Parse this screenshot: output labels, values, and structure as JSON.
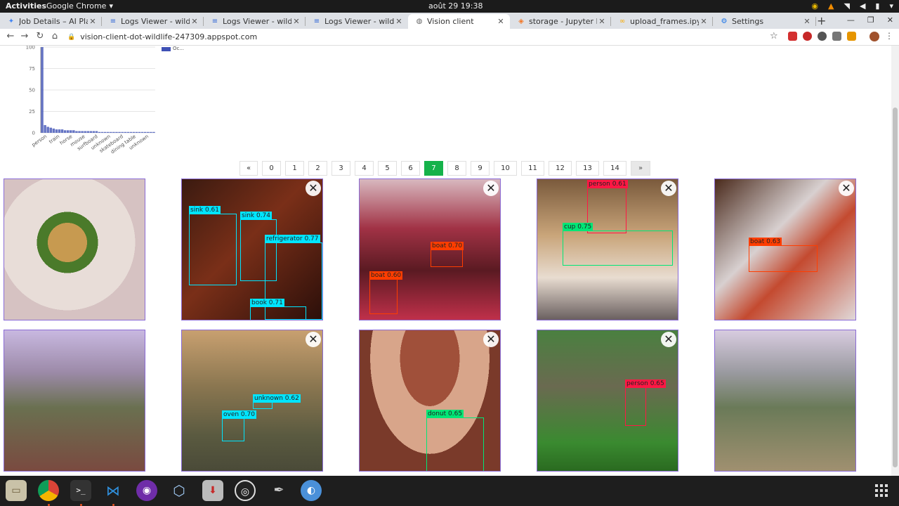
{
  "topbar": {
    "activities": "Activities",
    "app": "Google Chrome",
    "clock": "août 29  19:38"
  },
  "tabs": [
    {
      "label": "Job Details – AI Platfo",
      "icon": "ai-platform-icon",
      "icon_color": "#4285f4"
    },
    {
      "label": "Logs Viewer - wildlife",
      "icon": "logs-icon",
      "icon_color": "#3367d6"
    },
    {
      "label": "Logs Viewer - wildlife",
      "icon": "logs-icon",
      "icon_color": "#3367d6"
    },
    {
      "label": "Logs Viewer - wildlife",
      "icon": "logs-icon",
      "icon_color": "#3367d6"
    },
    {
      "label": "Vision client",
      "icon": "globe-icon",
      "icon_color": "#666666"
    },
    {
      "label": "storage - Jupyter Note",
      "icon": "jupyter-icon",
      "icon_color": "#f37726"
    },
    {
      "label": "upload_frames.ipynb",
      "icon": "colab-icon",
      "icon_color": "#f9ab00"
    },
    {
      "label": "Settings",
      "icon": "gear-icon",
      "icon_color": "#1a73e8"
    }
  ],
  "address": {
    "url": "vision-client-dot-wildlife-247309.appspot.com"
  },
  "chart_data": {
    "type": "bar",
    "categories": [
      "person",
      "",
      "train",
      "",
      "horse",
      "",
      "mouse",
      "",
      "surfboard",
      "",
      "unknown",
      "",
      "skateboard",
      "",
      "dining table",
      "",
      "unknown"
    ],
    "tick_labels": [
      "person",
      "train",
      "horse",
      "mouse",
      "surfboard",
      "unknown",
      "skateboard",
      "dining table",
      "unknown"
    ],
    "values": [
      100,
      9,
      7,
      6,
      5,
      4,
      4,
      4,
      3,
      3,
      3,
      3,
      2,
      2,
      2,
      2,
      2,
      2,
      2,
      2,
      1,
      1,
      1,
      1,
      1,
      1,
      1,
      1,
      1,
      1,
      1,
      1,
      1,
      1,
      1,
      1,
      1,
      1,
      1,
      1
    ],
    "yticks": [
      "100",
      "75",
      "50",
      "25",
      "0"
    ],
    "ylim": [
      0,
      100
    ],
    "legend": "Oc...",
    "color": "#3f51b5"
  },
  "pager": {
    "items": [
      "«",
      "0",
      "1",
      "2",
      "3",
      "4",
      "5",
      "6",
      "7",
      "8",
      "9",
      "10",
      "11",
      "12",
      "13",
      "14",
      "»"
    ],
    "active": "7"
  },
  "cards": [
    {
      "dets": [],
      "closable": false
    },
    {
      "dets": [
        {
          "label": "sink 0.61",
          "color": "#00e5ff"
        },
        {
          "label": "sink 0.74",
          "color": "#00e5ff"
        },
        {
          "label": "refrigerator 0.77",
          "color": "#00e5ff"
        },
        {
          "label": "book 0.71",
          "color": "#00e5ff"
        }
      ],
      "closable": true
    },
    {
      "dets": [
        {
          "label": "boat 0.70",
          "color": "#ff3d00"
        },
        {
          "label": "boat 0.60",
          "color": "#ff3d00"
        }
      ],
      "closable": true
    },
    {
      "dets": [
        {
          "label": "person 0.61",
          "color": "#ff1744"
        },
        {
          "label": "cup 0.75",
          "color": "#00e676"
        }
      ],
      "closable": true
    },
    {
      "dets": [
        {
          "label": "boat 0.63",
          "color": "#ff3d00"
        }
      ],
      "closable": true
    },
    {
      "dets": [],
      "closable": false
    },
    {
      "dets": [
        {
          "label": "unknown 0.62",
          "color": "#00e5ff"
        },
        {
          "label": "oven 0.70",
          "color": "#00e5ff"
        }
      ],
      "closable": true
    },
    {
      "dets": [
        {
          "label": "donut 0.65",
          "color": "#00e676"
        }
      ],
      "closable": true
    },
    {
      "dets": [
        {
          "label": "person 0.65",
          "color": "#ff1744"
        }
      ],
      "closable": true
    },
    {
      "dets": [],
      "closable": false
    }
  ],
  "close_glyph": "✕"
}
